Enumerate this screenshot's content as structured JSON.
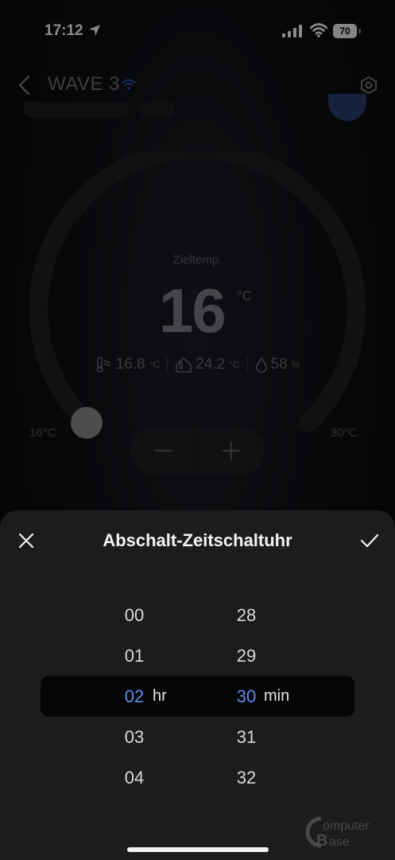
{
  "status_bar": {
    "time": "17:12",
    "battery": "70"
  },
  "header": {
    "device_name": "WAVE 3"
  },
  "dial": {
    "label": "Zieltemp.",
    "target_temp": "16",
    "unit": "°C",
    "min_label": "16°C",
    "max_label": "30°C",
    "readings": [
      {
        "icon": "thermometer-air-icon",
        "value": "16.8",
        "unit": "°C"
      },
      {
        "icon": "house-temperature-icon",
        "value": "24.2",
        "unit": "°C"
      },
      {
        "icon": "humidity-drop-icon",
        "value": "58",
        "unit": "%"
      }
    ]
  },
  "sheet": {
    "title": "Abschalt-Zeitschaltuhr",
    "hours": [
      "00",
      "01",
      "02",
      "03",
      "04"
    ],
    "minutes": [
      "28",
      "29",
      "30",
      "31",
      "32"
    ],
    "hour_unit": "hr",
    "minute_unit": "min",
    "selected_index": 2
  },
  "watermark": {
    "text": "ComputerBase"
  },
  "colors": {
    "accent": "#5b8def",
    "sheet_bg": "#1c1c1e",
    "power_button": "#2a3e6e"
  }
}
